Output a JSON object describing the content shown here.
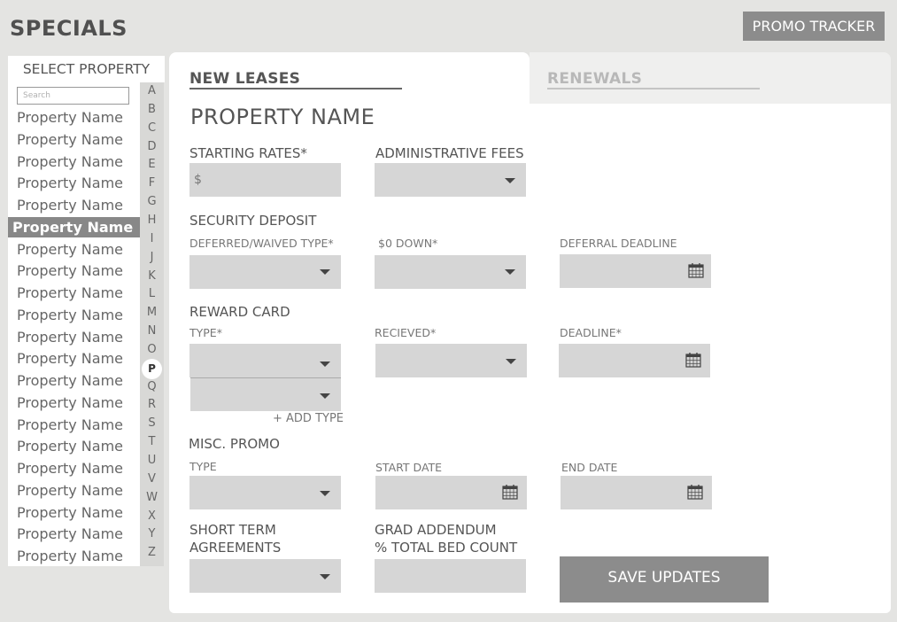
{
  "header": {
    "title": "SPECIALS",
    "promo_button": "PROMO TRACKER"
  },
  "sidebar": {
    "header": "SELECT PROPERTY",
    "search_placeholder": "Search",
    "properties": [
      "Property Name",
      "Property Name",
      "Property Name",
      "Property Name",
      "Property Name",
      "Property Name",
      "Property Name",
      "Property Name",
      "Property Name",
      "Property Name",
      "Property Name",
      "Property Name",
      "Property Name",
      "Property Name",
      "Property Name",
      "Property Name",
      "Property Name",
      "Property Name",
      "Property Name",
      "Property Name",
      "Property Name"
    ],
    "selected_index": 5,
    "alphabet": [
      "A",
      "B",
      "C",
      "D",
      "E",
      "F",
      "G",
      "H",
      "I",
      "J",
      "K",
      "L",
      "M",
      "N",
      "O",
      "P",
      "Q",
      "R",
      "S",
      "T",
      "U",
      "V",
      "W",
      "X",
      "Y",
      "Z"
    ],
    "active_letter": "P"
  },
  "tabs": {
    "new_leases": "NEW LEASES",
    "renewals": "RENEWALS"
  },
  "form": {
    "property_title": "PROPERTY NAME",
    "starting_rates_label": "STARTING RATES*",
    "starting_rates_value": "$",
    "admin_fees_label": "ADMINISTRATIVE FEES",
    "security_deposit_label": "SECURITY DEPOSIT",
    "deferred_type_label": "DEFERRED/WAIVED TYPE*",
    "zero_down_label": "$0 DOWN*",
    "deferral_deadline_label": "DEFERRAL DEADLINE",
    "reward_card_label": "REWARD CARD",
    "reward_type_label": "TYPE*",
    "reward_received_label": "RECIEVED*",
    "reward_deadline_label": "DEADLINE*",
    "add_type_label": "+ ADD TYPE",
    "misc_promo_label": "MISC. PROMO",
    "misc_type_label": "TYPE",
    "start_date_label": "START DATE",
    "end_date_label": "END DATE",
    "short_term_label_1": "SHORT TERM",
    "short_term_label_2": "AGREEMENTS",
    "grad_addendum_label_1": "GRAD ADDENDUM",
    "grad_addendum_label_2": "% TOTAL BED COUNT",
    "save_button": "SAVE UPDATES"
  },
  "icons": {
    "dropdown": "chevron-down-icon",
    "calendar": "calendar-icon"
  },
  "colors": {
    "background": "#e4e4e2",
    "button": "#8c8c8c",
    "field": "#d6d6d6",
    "panel": "#ffffff"
  }
}
